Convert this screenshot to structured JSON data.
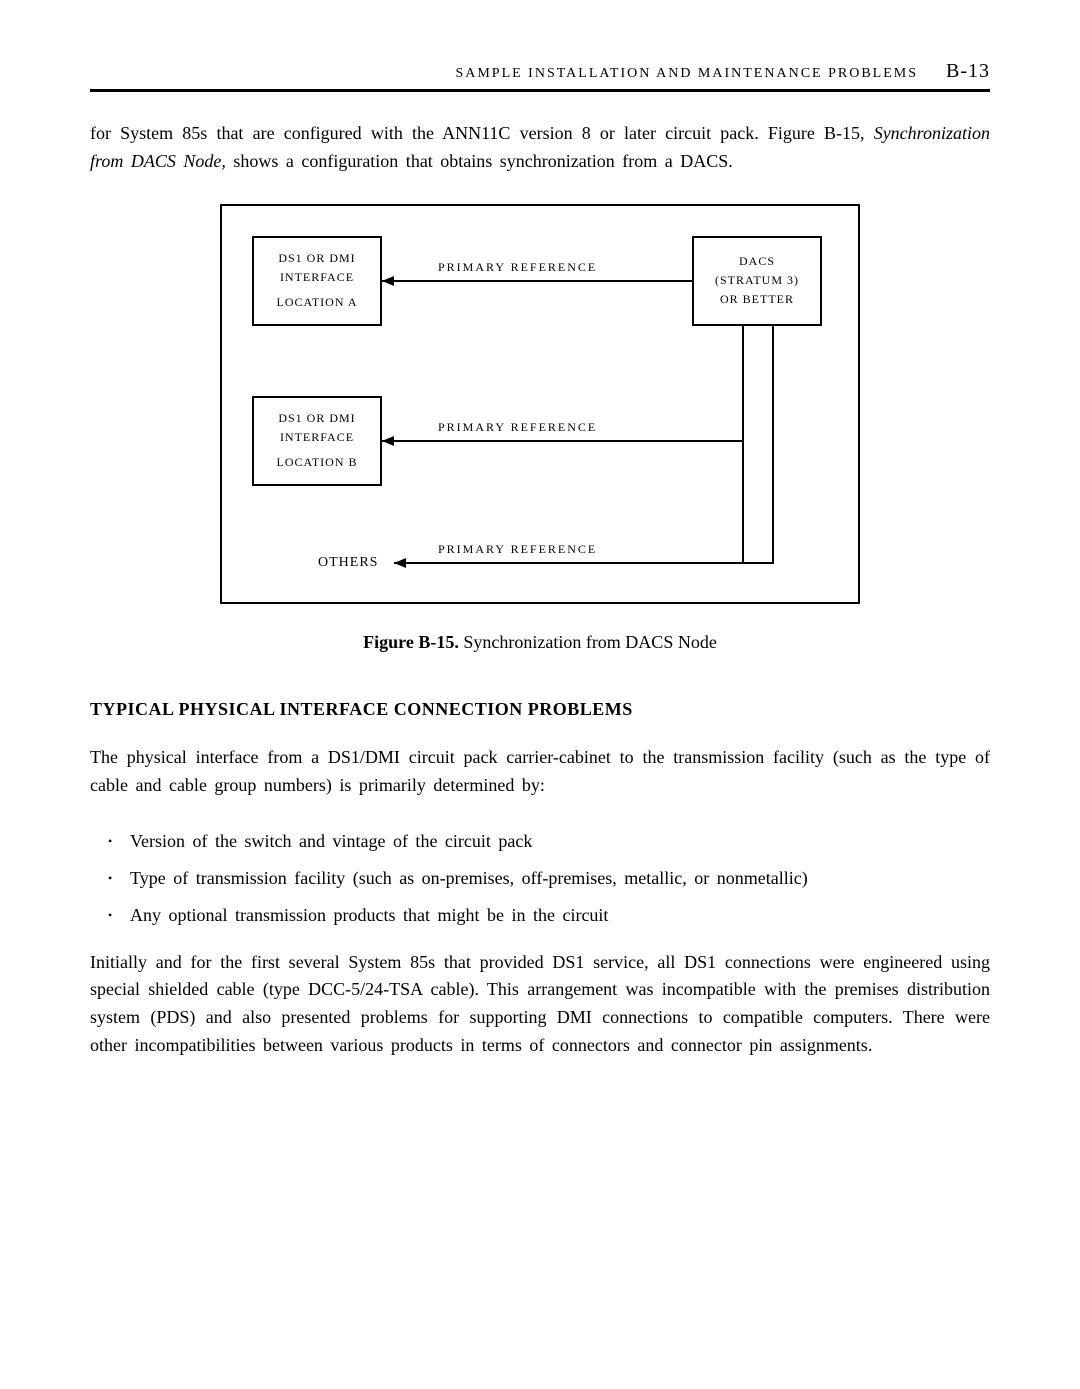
{
  "header": {
    "title": "SAMPLE   INSTALLATION   AND   MAINTENANCE   PROBLEMS",
    "page": "B-13"
  },
  "intro": {
    "line1": "for  System  85s  that  are  configured  with  the  ANN11C  version  8  or  later  circuit  pack.  Figure  B-15,",
    "italic": "Synchronization  from  DACS  Node,",
    "rest": "  shows  a  configuration  that  obtains  synchronization  from  a  DACS."
  },
  "figure": {
    "boxA": {
      "l1": "DS1 OR DMI",
      "l2": "INTERFACE",
      "l3": "LOCATION  A"
    },
    "boxB": {
      "l1": "DS1 OR DMI",
      "l2": "INTERFACE",
      "l3": "LOCATION  B"
    },
    "dacs": {
      "l1": "DACS",
      "l2": "(STRATUM  3)",
      "l3": "OR  BETTER"
    },
    "lbl1": "PRIMARY   REFERENCE",
    "lbl2": "PRIMARY   REFERENCE",
    "lbl3": "PRIMARY   REFERENCE",
    "others": "OTHERS"
  },
  "caption": {
    "bold": "Figure B-15.",
    "rest": " Synchronization  from  DACS  Node"
  },
  "section_heading": "TYPICAL PHYSICAL INTERFACE CONNECTION PROBLEMS",
  "para2": "The  physical  interface  from  a  DS1/DMI  circuit  pack  carrier-cabinet  to  the  transmission  facility  (such as  the  type  of  cable  and  cable  group  numbers)  is  primarily  determined  by:",
  "bullets": [
    "Version  of  the  switch  and  vintage  of  the  circuit  pack",
    "Type  of  transmission  facility  (such  as  on-premises,  off-premises,  metallic,  or  nonmetallic)",
    "Any  optional  transmission  products  that  might  be  in  the  circuit"
  ],
  "para3": "Initially  and  for  the  first  several  System  85s  that  provided  DS1  service,  all  DS1  connections  were engineered  using  special  shielded  cable  (type  DCC-5/24-TSA  cable).  This  arrangement  was incompatible  with  the  premises  distribution  system  (PDS)  and  also  presented  problems  for  supporting DMI  connections  to  compatible  computers.  There  were  other  incompatibilities  between  various products  in  terms  of  connectors  and  connector  pin  assignments."
}
